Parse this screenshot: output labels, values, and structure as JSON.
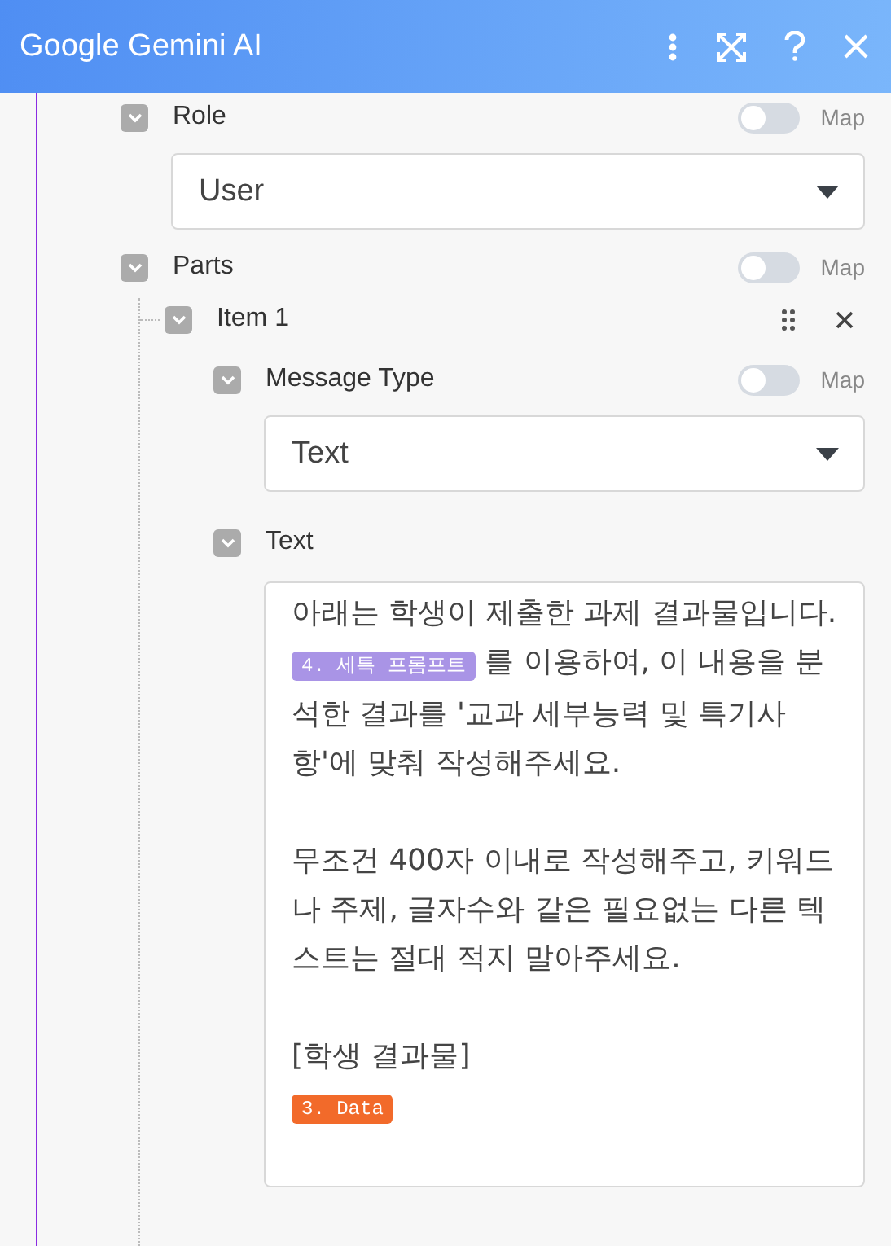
{
  "window": {
    "title": "Google Gemini AI"
  },
  "fields": [
    {
      "kind": "select",
      "label": "Role",
      "expanded": true,
      "map": false,
      "map_label": "Map",
      "value": "User"
    },
    {
      "kind": "array",
      "label": "Parts",
      "expanded": true,
      "map": false,
      "map_label": "Map",
      "items": [
        {
          "label": "Item 1",
          "expanded": true,
          "fields": [
            {
              "kind": "select",
              "label": "Message Type",
              "expanded": true,
              "map": false,
              "map_label": "Map",
              "value": "Text"
            },
            {
              "kind": "textarea",
              "label": "Text",
              "expanded": true,
              "paragraphs": [
                [
                  {
                    "kind": "text",
                    "text": "아래는 학생이 제출한 과제 결과물입니다. "
                  },
                  {
                    "kind": "pill",
                    "text": "4. 세특 프롬프트",
                    "color": "#a994e6"
                  },
                  {
                    "kind": "text",
                    "text": " 를 이용하여, 이 내용을 분석한 결과를 '교과 세부능력 및 특기사항'에 맞춰 작성해주세요."
                  }
                ],
                [
                  {
                    "kind": "text",
                    "text": "무조건 400자 이내로 작성해주고, 키워드나 주제, 글자수와 같은 필요없는 다른 텍스트는 절대 적지 말아주세요."
                  }
                ],
                [
                  {
                    "kind": "text",
                    "text": "[학생 결과물]"
                  },
                  {
                    "kind": "break"
                  },
                  {
                    "kind": "pill",
                    "text": "3. Data",
                    "color": "#f26a2a"
                  }
                ]
              ]
            }
          ]
        }
      ]
    }
  ]
}
